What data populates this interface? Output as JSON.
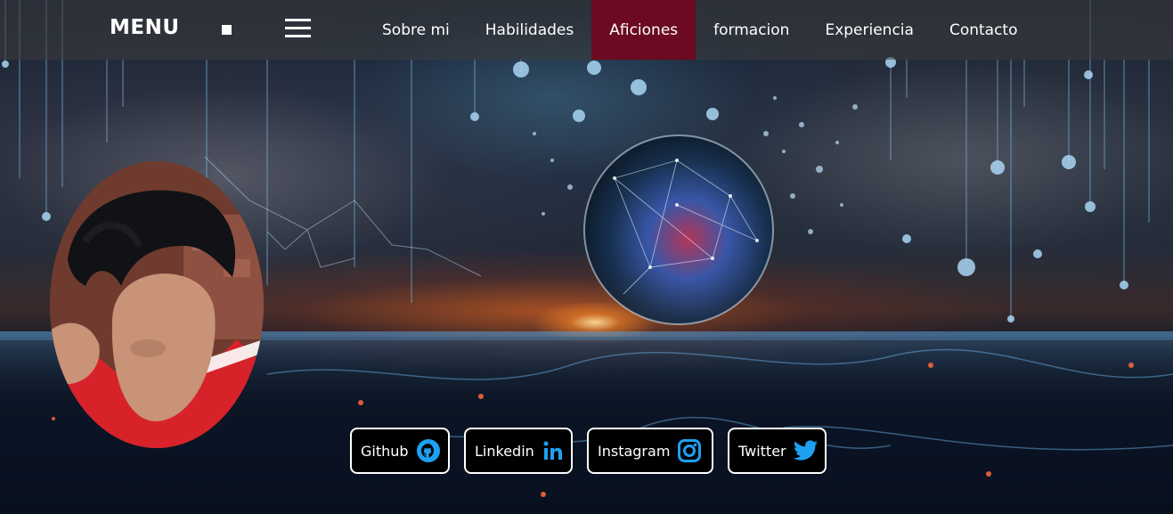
{
  "navbar": {
    "brand": "MENU",
    "links": [
      {
        "label": "Sobre mi",
        "active": false
      },
      {
        "label": "Habilidades",
        "active": false
      },
      {
        "label": "Aficiones",
        "active": true
      },
      {
        "label": "formacion",
        "active": false
      },
      {
        "label": "Experiencia",
        "active": false
      },
      {
        "label": "Contacto",
        "active": false
      }
    ],
    "active_color": "#6b0a20"
  },
  "social": [
    {
      "label": "Github",
      "icon": "github-icon"
    },
    {
      "label": "Linkedin",
      "icon": "linkedin-icon"
    },
    {
      "label": "Instagram",
      "icon": "instagram-icon"
    },
    {
      "label": "Twitter",
      "icon": "twitter-icon"
    }
  ],
  "colors": {
    "icon_accent": "#1da1f2",
    "button_bg": "#000000",
    "button_border": "#ffffff"
  }
}
